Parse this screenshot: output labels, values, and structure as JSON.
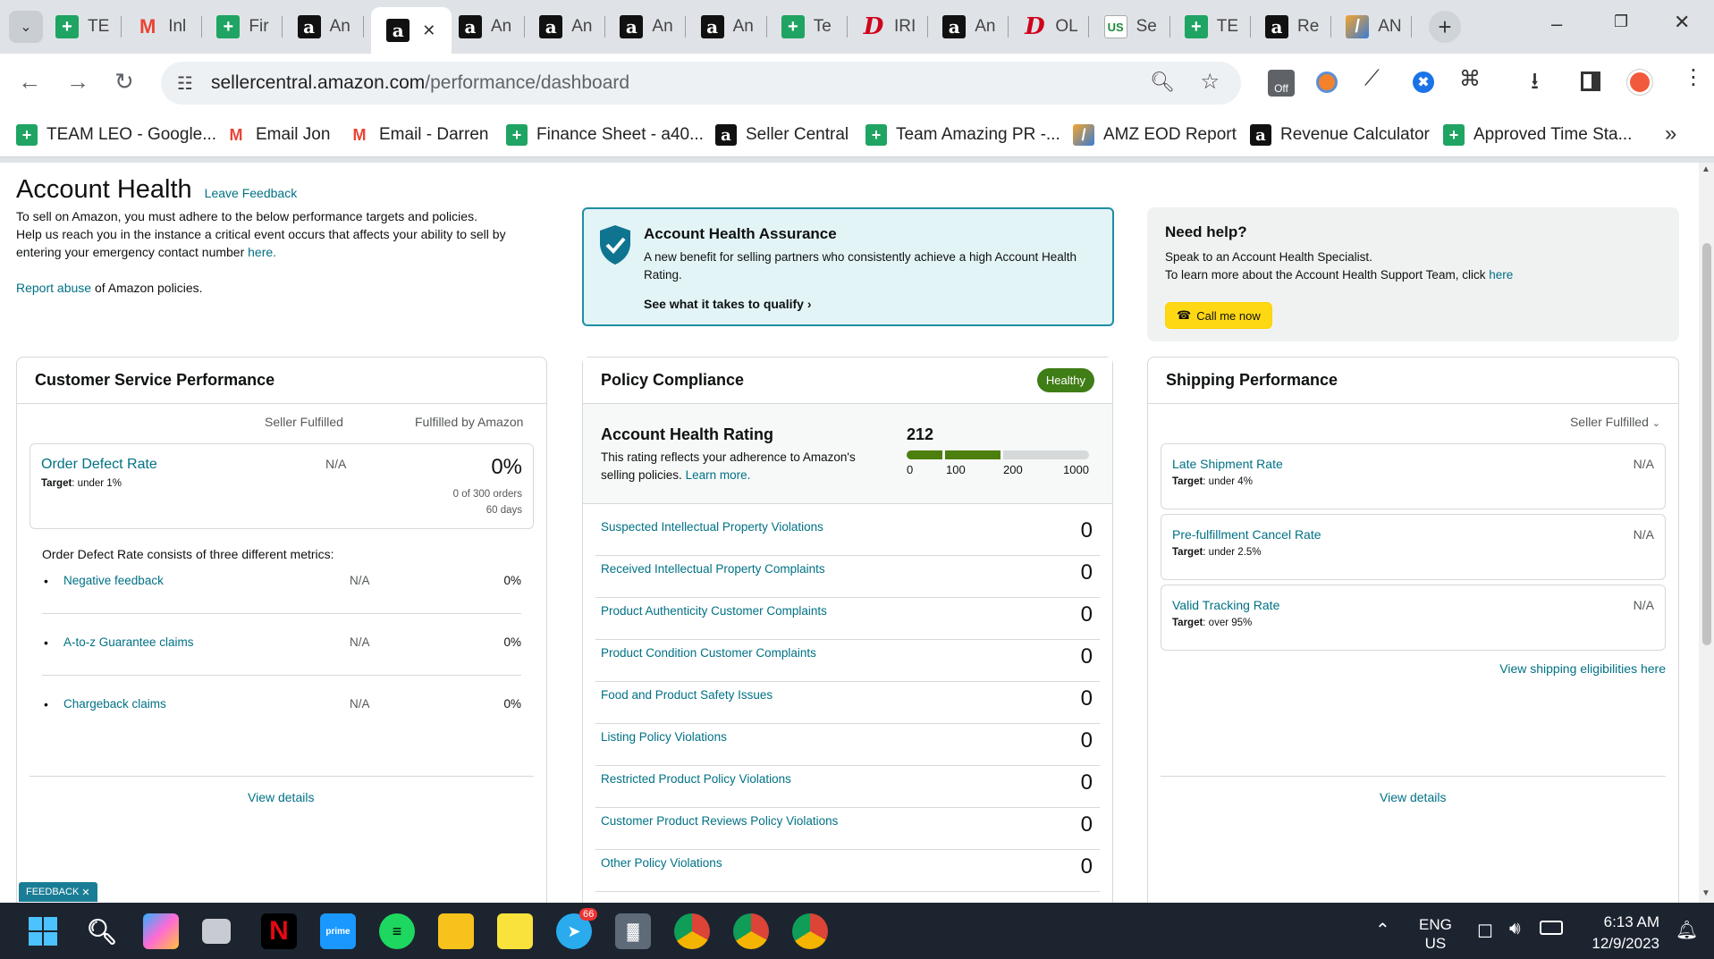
{
  "browser": {
    "tabs": [
      {
        "title": "TE",
        "icon": "google-sheets-icon"
      },
      {
        "title": "Inl",
        "icon": "gmail-icon"
      },
      {
        "title": "Fir",
        "icon": "google-sheets-icon"
      },
      {
        "title": "An",
        "icon": "amazon-icon"
      },
      {
        "title": "",
        "icon": "amazon-icon",
        "active": true
      },
      {
        "title": "An",
        "icon": "amazon-icon"
      },
      {
        "title": "An",
        "icon": "amazon-icon"
      },
      {
        "title": "An",
        "icon": "amazon-icon"
      },
      {
        "title": "An",
        "icon": "amazon-icon"
      },
      {
        "title": "Te",
        "icon": "google-sheets-icon"
      },
      {
        "title": "IRI",
        "icon": "pinterest-icon"
      },
      {
        "title": "An",
        "icon": "amazon-icon"
      },
      {
        "title": "OL",
        "icon": "pinterest-icon"
      },
      {
        "title": "Se",
        "icon": "usfoods-icon"
      },
      {
        "title": "TE",
        "icon": "google-sheets-icon"
      },
      {
        "title": "Re",
        "icon": "amazon-icon"
      },
      {
        "title": "AN",
        "icon": "pen-icon"
      }
    ],
    "url_domain": "sellercentral.amazon.com",
    "url_path": "/performance/dashboard",
    "bookmarks": [
      {
        "label": "TEAM LEO - Google...",
        "icon": "google-sheets-icon"
      },
      {
        "label": "Email Jon",
        "icon": "gmail-icon"
      },
      {
        "label": "Email - Darren",
        "icon": "gmail-icon"
      },
      {
        "label": "Finance Sheet - a40...",
        "icon": "google-sheets-icon"
      },
      {
        "label": "Seller Central",
        "icon": "amazon-icon"
      },
      {
        "label": "Team Amazing PR -...",
        "icon": "google-sheets-icon"
      },
      {
        "label": "AMZ EOD Report",
        "icon": "pen-icon"
      },
      {
        "label": "Revenue Calculator",
        "icon": "amazon-icon"
      },
      {
        "label": "Approved Time Sta...",
        "icon": "google-sheets-icon"
      }
    ],
    "ext_badge": "Off"
  },
  "header": {
    "title": "Account Health",
    "feedback_link": "Leave Feedback",
    "intro_line1": "To sell on Amazon, you must adhere to the below performance targets and policies.",
    "intro_line2": "Help us reach you in the instance a critical event occurs that affects your ability to sell by",
    "intro_line3_text": "entering your emergency contact number",
    "intro_line3_link": "here.",
    "report_link": "Report abuse",
    "report_text": "of Amazon policies."
  },
  "assurance": {
    "title": "Account Health Assurance",
    "desc": "A new benefit for selling partners who consistently achieve a high Account Health Rating.",
    "link": "See what it takes to qualify"
  },
  "help": {
    "title": "Need help?",
    "line1": "Speak to an Account Health Specialist.",
    "line2": "To learn more about the Account Health Support Team, click",
    "line2_link": "here",
    "button": "Call me now"
  },
  "customer_service": {
    "title": "Customer Service Performance",
    "col1": "Seller Fulfilled",
    "col2": "Fulfilled by Amazon",
    "odr_label": "Order Defect Rate",
    "odr_target_label": "Target",
    "odr_target": ": under 1%",
    "odr_seller": "N/A",
    "odr_fba": "0%",
    "odr_orders": "0 of 300 orders",
    "odr_days": "60 days",
    "consists": "Order Defect Rate consists of three different metrics:",
    "metrics": [
      {
        "label": "Negative feedback",
        "seller": "N/A",
        "fba": "0%"
      },
      {
        "label": "A-to-z Guarantee claims",
        "seller": "N/A",
        "fba": "0%"
      },
      {
        "label": "Chargeback claims",
        "seller": "N/A",
        "fba": "0%"
      }
    ],
    "view": "View details"
  },
  "policy": {
    "title": "Policy Compliance",
    "badge": "Healthy",
    "ahr_title": "Account Health Rating",
    "ahr_desc1": "This rating reflects your adherence to Amazon's",
    "ahr_desc2": "selling policies.",
    "ahr_learn": "Learn more.",
    "rating": "212",
    "rating_value": 212,
    "scale": [
      "0",
      "100",
      "200",
      "1000"
    ],
    "violations": [
      {
        "label": "Suspected Intellectual Property Violations",
        "count": "0"
      },
      {
        "label": "Received Intellectual Property Complaints",
        "count": "0"
      },
      {
        "label": "Product Authenticity Customer Complaints",
        "count": "0"
      },
      {
        "label": "Product Condition Customer Complaints",
        "count": "0"
      },
      {
        "label": "Food and Product Safety Issues",
        "count": "0"
      },
      {
        "label": "Listing Policy Violations",
        "count": "0"
      },
      {
        "label": "Restricted Product Policy Violations",
        "count": "0"
      },
      {
        "label": "Customer Product Reviews Policy Violations",
        "count": "0"
      },
      {
        "label": "Other Policy Violations",
        "count": "0"
      }
    ],
    "colors": {
      "good": "#4d7f0f",
      "track": "#d5d9d9",
      "badge": "#3f7d16"
    }
  },
  "shipping": {
    "title": "Shipping Performance",
    "filter": "Seller Fulfilled",
    "metrics": [
      {
        "label": "Late Shipment Rate",
        "target_label": "Target",
        "target": ": under 4%",
        "value": "N/A"
      },
      {
        "label": "Pre-fulfillment Cancel Rate",
        "target_label": "Target",
        "target": ": under 2.5%",
        "value": "N/A"
      },
      {
        "label": "Valid Tracking Rate",
        "target_label": "Target",
        "target": ": over 95%",
        "value": "N/A"
      }
    ],
    "eligibility": "View shipping eligibilities here",
    "view": "View details"
  },
  "feedback_tab": "FEEDBACK",
  "taskbar": {
    "lang1": "ENG",
    "lang2": "US",
    "time": "6:13 AM",
    "date": "12/9/2023",
    "telegram_badge": "66"
  }
}
